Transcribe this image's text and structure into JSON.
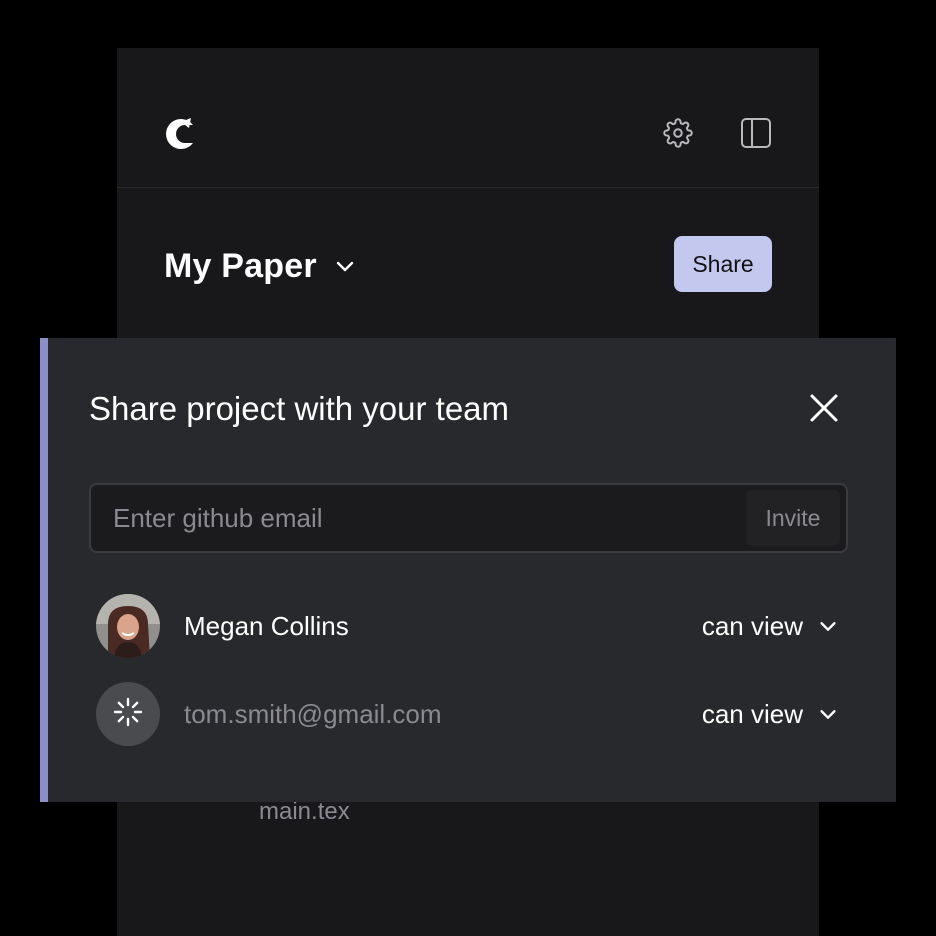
{
  "project": {
    "title": "My Paper",
    "share_label": "Share"
  },
  "files": [
    {
      "name": "main.tex"
    }
  ],
  "share_dialog": {
    "title": "Share project with your team",
    "invite": {
      "placeholder": "Enter github email",
      "button_label": "Invite"
    },
    "members": [
      {
        "name": "Megan Collins",
        "permission": "can view",
        "status": "active"
      },
      {
        "name": "tom.smith@gmail.com",
        "permission": "can view",
        "status": "pending"
      }
    ]
  },
  "colors": {
    "accent": "#8b8fc7",
    "share_button": "#c5c8ee",
    "panel": "#18181b",
    "dialog": "#28292c"
  },
  "icons": {
    "logo": "app-logo",
    "settings": "gear-icon",
    "sidebar_toggle": "sidebar-icon",
    "close": "close-icon",
    "dropdown": "chevron-down-icon",
    "pending": "spinner-icon"
  }
}
